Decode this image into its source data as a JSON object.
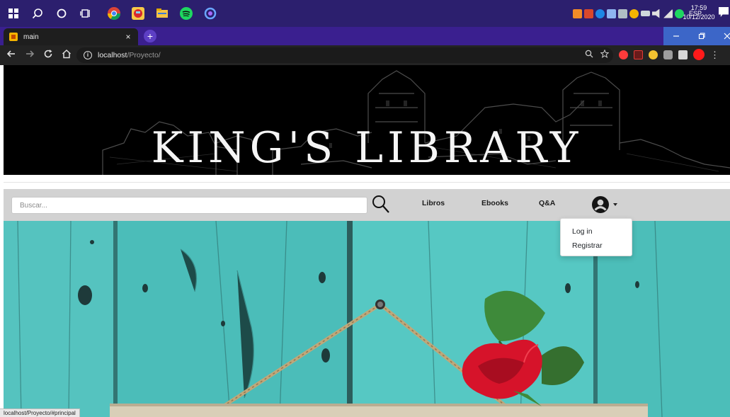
{
  "taskbar": {
    "tray_lang": "ESP",
    "clock_time": "17:59",
    "clock_date": "10/12/2020"
  },
  "browser": {
    "tab_title": "main",
    "tab_close": "×",
    "new_tab": "+",
    "url_host": "localhost",
    "url_path": "/Proyecto/",
    "status_url": "localhost/Proyecto/#principal"
  },
  "site": {
    "banner_title": "KING'S LIBRARY"
  },
  "navbar": {
    "search_placeholder": "Buscar...",
    "links": {
      "libros": "Libros",
      "ebooks": "Ebooks",
      "qa": "Q&A"
    }
  },
  "user_menu": {
    "login": "Log in",
    "register": "Registrar"
  },
  "colors": {
    "taskbar": "#2c1f6e",
    "tabstrip": "#3a1f8f",
    "navbar": "#d2d2d2",
    "wood": "#4fc1bd"
  },
  "icons": [
    "windows-icon",
    "search-icon",
    "cortana-icon",
    "task-view-icon",
    "chrome-icon",
    "game-icon",
    "explorer-icon",
    "spotify-icon",
    "app-icon",
    "info-icon",
    "zoom-icon",
    "star-icon",
    "user-icon"
  ]
}
